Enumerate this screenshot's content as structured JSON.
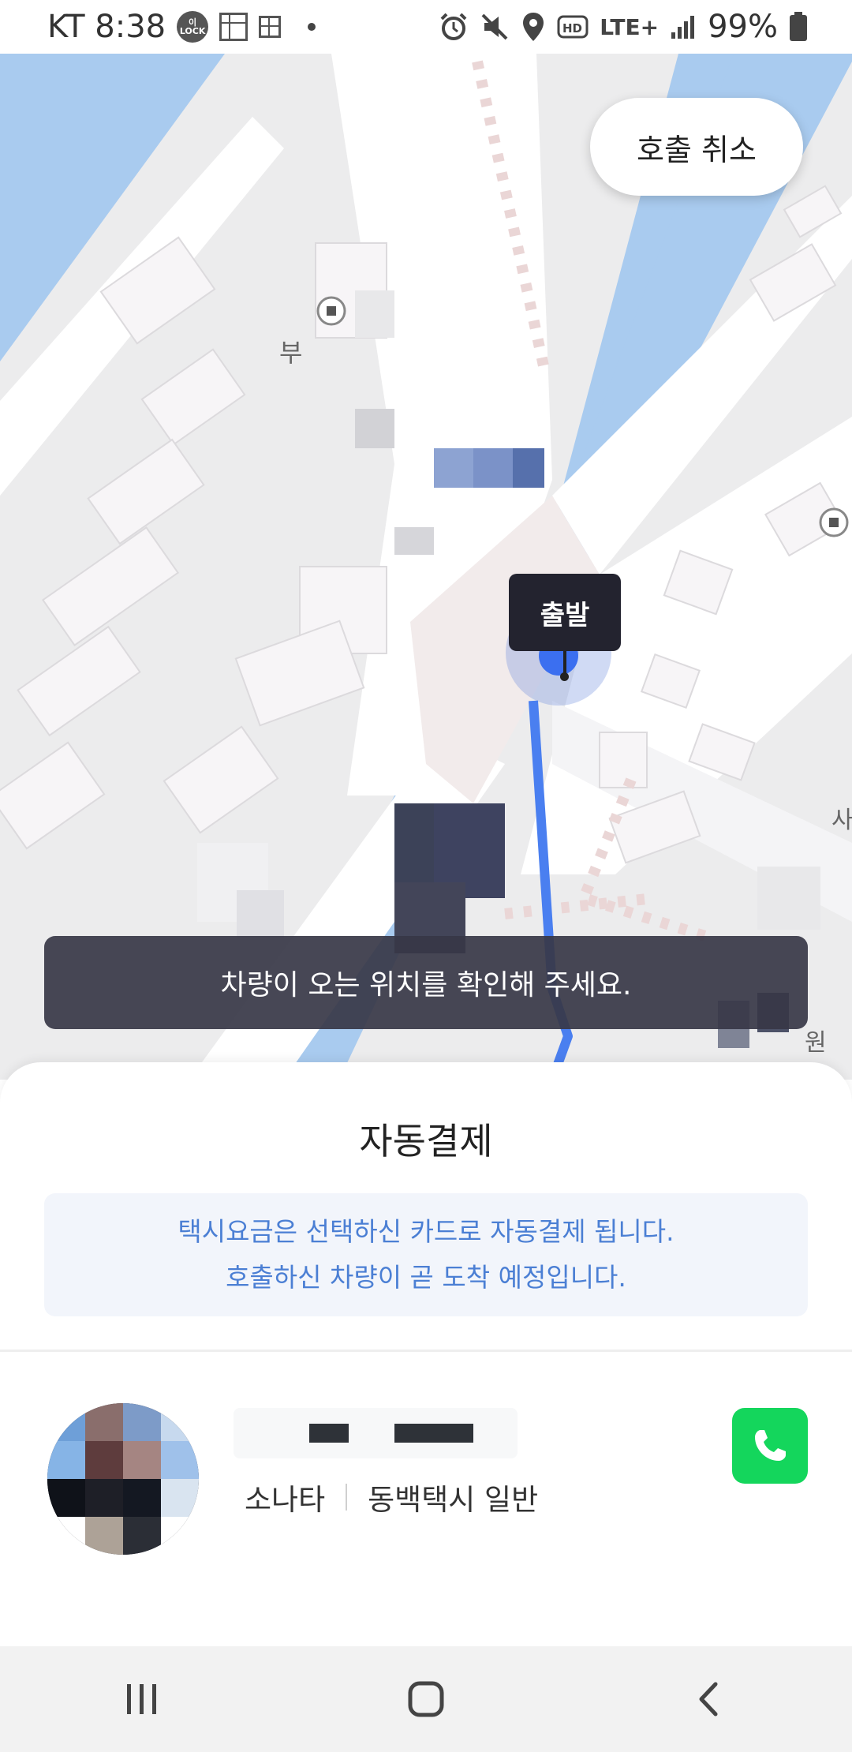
{
  "status_bar": {
    "carrier_time": "KT 8:38",
    "lock_badge": "이LOCK",
    "battery": "99%",
    "network": "LTE+"
  },
  "map": {
    "labels": {
      "building_bu": "부",
      "east_label_1": "사",
      "east_label_2": "원"
    },
    "cancel_label": "호출 취소",
    "departure_label": "출발",
    "notice": "차량이 오는 위치를 확인해 주세요."
  },
  "sheet": {
    "title": "자동결제",
    "info_line1": "택시요금은 선택하신 카드로 자동결제 됩니다.",
    "info_line2": "호출하신 차량이 곧 도착 예정입니다.",
    "vehicle_model": "소나타",
    "taxi_type": "동백택시 일반"
  },
  "colors": {
    "route_blue": "#4a7ff0",
    "call_button_green": "#14d65c",
    "info_text_blue": "#4b7fd4",
    "notice_bg": "#373746",
    "water": "#a9cbef"
  },
  "icons": {
    "call": "phone-icon",
    "nav_recent": "recent-apps-icon",
    "nav_home": "home-icon",
    "nav_back": "back-icon"
  }
}
